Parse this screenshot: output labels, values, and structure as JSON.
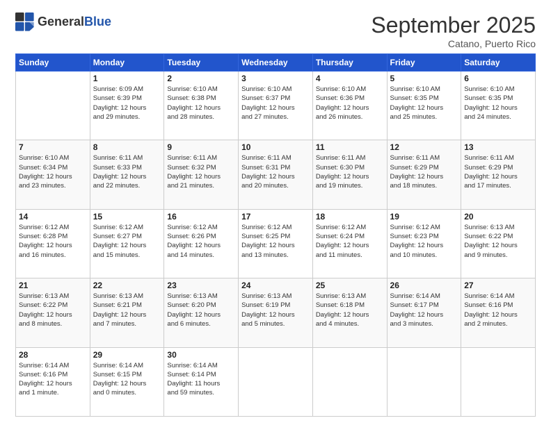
{
  "header": {
    "logo_general": "General",
    "logo_blue": "Blue",
    "month_title": "September 2025",
    "location": "Catano, Puerto Rico"
  },
  "weekdays": [
    "Sunday",
    "Monday",
    "Tuesday",
    "Wednesday",
    "Thursday",
    "Friday",
    "Saturday"
  ],
  "weeks": [
    [
      {
        "num": "",
        "info": ""
      },
      {
        "num": "1",
        "info": "Sunrise: 6:09 AM\nSunset: 6:39 PM\nDaylight: 12 hours\nand 29 minutes."
      },
      {
        "num": "2",
        "info": "Sunrise: 6:10 AM\nSunset: 6:38 PM\nDaylight: 12 hours\nand 28 minutes."
      },
      {
        "num": "3",
        "info": "Sunrise: 6:10 AM\nSunset: 6:37 PM\nDaylight: 12 hours\nand 27 minutes."
      },
      {
        "num": "4",
        "info": "Sunrise: 6:10 AM\nSunset: 6:36 PM\nDaylight: 12 hours\nand 26 minutes."
      },
      {
        "num": "5",
        "info": "Sunrise: 6:10 AM\nSunset: 6:35 PM\nDaylight: 12 hours\nand 25 minutes."
      },
      {
        "num": "6",
        "info": "Sunrise: 6:10 AM\nSunset: 6:35 PM\nDaylight: 12 hours\nand 24 minutes."
      }
    ],
    [
      {
        "num": "7",
        "info": "Sunrise: 6:10 AM\nSunset: 6:34 PM\nDaylight: 12 hours\nand 23 minutes."
      },
      {
        "num": "8",
        "info": "Sunrise: 6:11 AM\nSunset: 6:33 PM\nDaylight: 12 hours\nand 22 minutes."
      },
      {
        "num": "9",
        "info": "Sunrise: 6:11 AM\nSunset: 6:32 PM\nDaylight: 12 hours\nand 21 minutes."
      },
      {
        "num": "10",
        "info": "Sunrise: 6:11 AM\nSunset: 6:31 PM\nDaylight: 12 hours\nand 20 minutes."
      },
      {
        "num": "11",
        "info": "Sunrise: 6:11 AM\nSunset: 6:30 PM\nDaylight: 12 hours\nand 19 minutes."
      },
      {
        "num": "12",
        "info": "Sunrise: 6:11 AM\nSunset: 6:29 PM\nDaylight: 12 hours\nand 18 minutes."
      },
      {
        "num": "13",
        "info": "Sunrise: 6:11 AM\nSunset: 6:29 PM\nDaylight: 12 hours\nand 17 minutes."
      }
    ],
    [
      {
        "num": "14",
        "info": "Sunrise: 6:12 AM\nSunset: 6:28 PM\nDaylight: 12 hours\nand 16 minutes."
      },
      {
        "num": "15",
        "info": "Sunrise: 6:12 AM\nSunset: 6:27 PM\nDaylight: 12 hours\nand 15 minutes."
      },
      {
        "num": "16",
        "info": "Sunrise: 6:12 AM\nSunset: 6:26 PM\nDaylight: 12 hours\nand 14 minutes."
      },
      {
        "num": "17",
        "info": "Sunrise: 6:12 AM\nSunset: 6:25 PM\nDaylight: 12 hours\nand 13 minutes."
      },
      {
        "num": "18",
        "info": "Sunrise: 6:12 AM\nSunset: 6:24 PM\nDaylight: 12 hours\nand 11 minutes."
      },
      {
        "num": "19",
        "info": "Sunrise: 6:12 AM\nSunset: 6:23 PM\nDaylight: 12 hours\nand 10 minutes."
      },
      {
        "num": "20",
        "info": "Sunrise: 6:13 AM\nSunset: 6:22 PM\nDaylight: 12 hours\nand 9 minutes."
      }
    ],
    [
      {
        "num": "21",
        "info": "Sunrise: 6:13 AM\nSunset: 6:22 PM\nDaylight: 12 hours\nand 8 minutes."
      },
      {
        "num": "22",
        "info": "Sunrise: 6:13 AM\nSunset: 6:21 PM\nDaylight: 12 hours\nand 7 minutes."
      },
      {
        "num": "23",
        "info": "Sunrise: 6:13 AM\nSunset: 6:20 PM\nDaylight: 12 hours\nand 6 minutes."
      },
      {
        "num": "24",
        "info": "Sunrise: 6:13 AM\nSunset: 6:19 PM\nDaylight: 12 hours\nand 5 minutes."
      },
      {
        "num": "25",
        "info": "Sunrise: 6:13 AM\nSunset: 6:18 PM\nDaylight: 12 hours\nand 4 minutes."
      },
      {
        "num": "26",
        "info": "Sunrise: 6:14 AM\nSunset: 6:17 PM\nDaylight: 12 hours\nand 3 minutes."
      },
      {
        "num": "27",
        "info": "Sunrise: 6:14 AM\nSunset: 6:16 PM\nDaylight: 12 hours\nand 2 minutes."
      }
    ],
    [
      {
        "num": "28",
        "info": "Sunrise: 6:14 AM\nSunset: 6:16 PM\nDaylight: 12 hours\nand 1 minute."
      },
      {
        "num": "29",
        "info": "Sunrise: 6:14 AM\nSunset: 6:15 PM\nDaylight: 12 hours\nand 0 minutes."
      },
      {
        "num": "30",
        "info": "Sunrise: 6:14 AM\nSunset: 6:14 PM\nDaylight: 11 hours\nand 59 minutes."
      },
      {
        "num": "",
        "info": ""
      },
      {
        "num": "",
        "info": ""
      },
      {
        "num": "",
        "info": ""
      },
      {
        "num": "",
        "info": ""
      }
    ]
  ]
}
